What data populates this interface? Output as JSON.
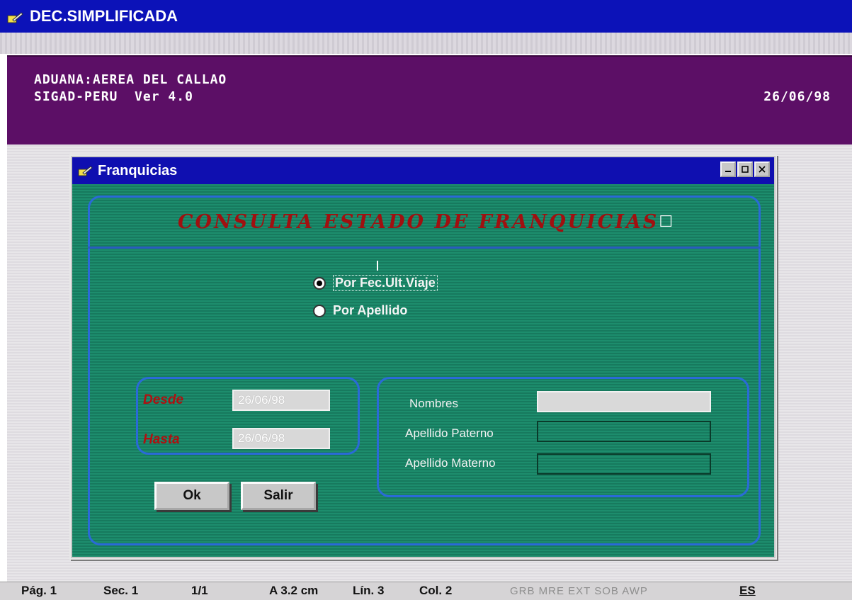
{
  "window": {
    "title": "DEC.SIMPLIFICADA"
  },
  "header": {
    "line1": "ADUANA:AEREA DEL CALLAO",
    "line2": "SIGAD-PERU  Ver 4.0",
    "date": "26/06/98"
  },
  "dialog": {
    "title": "Franquicias",
    "heading": "CONSULTA ESTADO DE FRANQUICIAS",
    "radio_options": [
      {
        "label": "Por Fec.Ult.Viaje",
        "selected": true
      },
      {
        "label": "Por Apellido",
        "selected": false
      }
    ],
    "date_range": {
      "desde_label": "Desde",
      "desde_value": "26/06/98",
      "hasta_label": "Hasta",
      "hasta_value": "26/06/98"
    },
    "name_fields": {
      "nombres_label": "Nombres",
      "paterno_label": "Apellido Paterno",
      "materno_label": "Apellido Materno"
    },
    "buttons": {
      "ok": "Ok",
      "salir": "Salir"
    }
  },
  "statusbar": {
    "page": "Pág. 1",
    "section": "Sec. 1",
    "pages": "1/1",
    "at": "A 3.2 cm",
    "line": "Lín. 3",
    "col": "Col. 2",
    "modes": "GRB  MRE  EXT  SOB  AWP",
    "lang": "ES"
  },
  "colors": {
    "titlebar": "#0c12b8",
    "header_band": "#5c0f66",
    "dialog_body": "#1c8a6b",
    "frame": "#2a6ad8",
    "heading": "#a01010"
  }
}
